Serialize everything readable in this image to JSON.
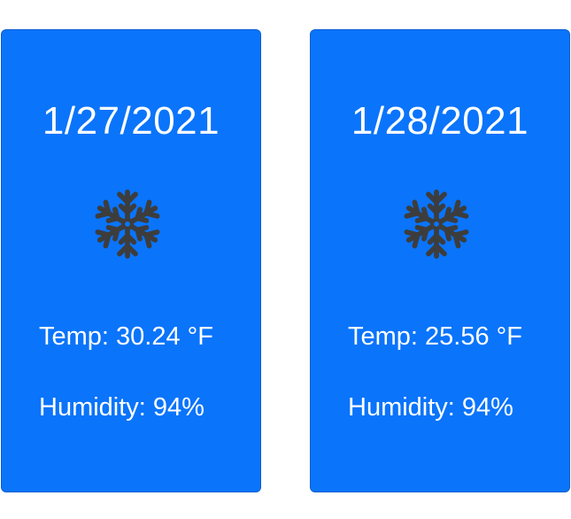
{
  "forecast": [
    {
      "date": "1/27/2021",
      "icon": "snowflake-icon",
      "temp": "Temp: 30.24 °F",
      "humidity": "Humidity: 94%"
    },
    {
      "date": "1/28/2021",
      "icon": "snowflake-icon",
      "temp": "Temp: 25.56 °F",
      "humidity": "Humidity: 94%"
    }
  ],
  "colors": {
    "card_background": "#0a74fb",
    "text": "#ffffff",
    "icon": "#3d3d3d"
  }
}
